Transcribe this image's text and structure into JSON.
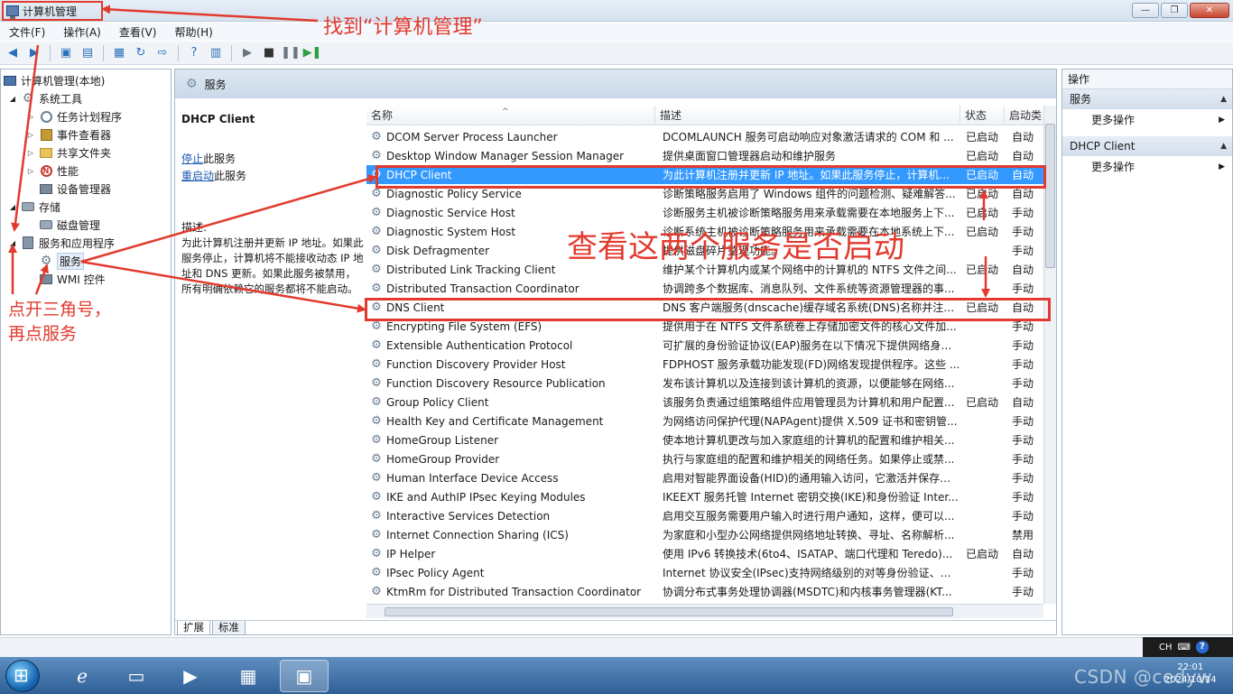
{
  "window": {
    "title": "计算机管理",
    "controls": [
      "—",
      "❐",
      "✕"
    ]
  },
  "menubar": {
    "items": [
      "文件(F)",
      "操作(A)",
      "查看(V)",
      "帮助(H)"
    ]
  },
  "tree": {
    "root": "计算机管理(本地)",
    "system_tools": "系统工具",
    "task_scheduler": "任务计划程序",
    "event_viewer": "事件查看器",
    "shared_folders": "共享文件夹",
    "performance": "性能",
    "device_manager": "设备管理器",
    "storage": "存储",
    "disk_management": "磁盘管理",
    "services_apps": "服务和应用程序",
    "services": "服务",
    "wmi_control": "WMI 控件"
  },
  "center": {
    "header": "服务",
    "detail": {
      "title": "DHCP Client",
      "stop_link": "停止",
      "stop_suffix": "此服务",
      "restart_link": "重启动",
      "restart_suffix": "此服务",
      "desc_label": "描述:",
      "desc": "为此计算机注册并更新 IP 地址。如果此服务停止，计算机将不能接收动态 IP 地址和 DNS 更新。如果此服务被禁用，所有明确依赖它的服务都将不能启动。"
    },
    "columns": {
      "name": "名称",
      "desc": "描述",
      "status": "状态",
      "startup": "启动类"
    },
    "services": [
      {
        "name": "DCOM Server Process Launcher",
        "desc": "DCOMLAUNCH 服务可启动响应对象激活请求的 COM 和 ...",
        "status": "已启动",
        "startup": "自动"
      },
      {
        "name": "Desktop Window Manager Session Manager",
        "desc": "提供桌面窗口管理器启动和维护服务",
        "status": "已启动",
        "startup": "自动"
      },
      {
        "name": "DHCP Client",
        "desc": "为此计算机注册并更新 IP 地址。如果此服务停止，计算机...",
        "status": "已启动",
        "startup": "自动"
      },
      {
        "name": "Diagnostic Policy Service",
        "desc": "诊断策略服务启用了 Windows 组件的问题检测、疑难解答...",
        "status": "已启动",
        "startup": "自动"
      },
      {
        "name": "Diagnostic Service Host",
        "desc": "诊断服务主机被诊断策略服务用来承载需要在本地服务上下...",
        "status": "已启动",
        "startup": "手动"
      },
      {
        "name": "Diagnostic System Host",
        "desc": "诊断系统主机被诊断策略服务用来承载需要在本地系统上下...",
        "status": "已启动",
        "startup": "手动"
      },
      {
        "name": "Disk Defragmenter",
        "desc": "提供磁盘碎片整理功能。",
        "status": "",
        "startup": "手动"
      },
      {
        "name": "Distributed Link Tracking Client",
        "desc": "维护某个计算机内或某个网络中的计算机的 NTFS 文件之间...",
        "status": "已启动",
        "startup": "自动"
      },
      {
        "name": "Distributed Transaction Coordinator",
        "desc": "协调跨多个数据库、消息队列、文件系统等资源管理器的事...",
        "status": "",
        "startup": "手动"
      },
      {
        "name": "DNS Client",
        "desc": "DNS 客户端服务(dnscache)缓存域名系统(DNS)名称并注册...",
        "status": "已启动",
        "startup": "自动"
      },
      {
        "name": "Encrypting File System (EFS)",
        "desc": "提供用于在 NTFS 文件系统卷上存储加密文件的核心文件加...",
        "status": "",
        "startup": "手动"
      },
      {
        "name": "Extensible Authentication Protocol",
        "desc": "可扩展的身份验证协议(EAP)服务在以下情况下提供网络身份...",
        "status": "",
        "startup": "手动"
      },
      {
        "name": "Function Discovery Provider Host",
        "desc": "FDPHOST 服务承载功能发现(FD)网络发现提供程序。这些 ...",
        "status": "",
        "startup": "手动"
      },
      {
        "name": "Function Discovery Resource Publication",
        "desc": "发布该计算机以及连接到该计算机的资源，以便能够在网络...",
        "status": "",
        "startup": "手动"
      },
      {
        "name": "Group Policy Client",
        "desc": "该服务负责通过组策略组件应用管理员为计算机和用户配置...",
        "status": "已启动",
        "startup": "自动"
      },
      {
        "name": "Health Key and Certificate Management",
        "desc": "为网络访问保护代理(NAPAgent)提供 X.509 证书和密钥管...",
        "status": "",
        "startup": "手动"
      },
      {
        "name": "HomeGroup Listener",
        "desc": "使本地计算机更改与加入家庭组的计算机的配置和维护相关...",
        "status": "",
        "startup": "手动"
      },
      {
        "name": "HomeGroup Provider",
        "desc": "执行与家庭组的配置和维护相关的网络任务。如果停止或禁...",
        "status": "",
        "startup": "手动"
      },
      {
        "name": "Human Interface Device Access",
        "desc": "启用对智能界面设备(HID)的通用输入访问，它激活并保存键...",
        "status": "",
        "startup": "手动"
      },
      {
        "name": "IKE and AuthIP IPsec Keying Modules",
        "desc": "IKEEXT 服务托管 Internet 密钥交换(IKE)和身份验证 Inter...",
        "status": "",
        "startup": "手动"
      },
      {
        "name": "Interactive Services Detection",
        "desc": "启用交互服务需要用户输入时进行用户通知，这样，便可以...",
        "status": "",
        "startup": "手动"
      },
      {
        "name": "Internet Connection Sharing (ICS)",
        "desc": "为家庭和小型办公网络提供网络地址转换、寻址、名称解析...",
        "status": "",
        "startup": "禁用"
      },
      {
        "name": "IP Helper",
        "desc": "使用 IPv6 转换技术(6to4、ISATAP、端口代理和 Teredo)...",
        "status": "已启动",
        "startup": "自动"
      },
      {
        "name": "IPsec Policy Agent",
        "desc": "Internet 协议安全(IPsec)支持网络级别的对等身份验证、数...",
        "status": "",
        "startup": "手动"
      },
      {
        "name": "KtmRm for Distributed Transaction Coordinator",
        "desc": "协调分布式事务处理协调器(MSDTC)和内核事务管理器(KT...",
        "status": "",
        "startup": "手动"
      }
    ],
    "tabs": [
      "扩展",
      "标准"
    ]
  },
  "actions": {
    "title": "操作",
    "section1": "服务",
    "more1": "更多操作",
    "section2": "DHCP Client",
    "more2": "更多操作"
  },
  "tray": {
    "lang": "CH",
    "help": "?",
    "time": "22:01",
    "date": "2024/10/14"
  },
  "watermark": "CSDN @cedyw",
  "annotations": {
    "find": "找到“计算机管理”",
    "check": "查看这两个服务是否启动",
    "expand_line1": "点开三角号，",
    "expand_line2": "再点服务"
  },
  "colors": {
    "annotation": "#e23a2e",
    "selection": "#3399ff"
  }
}
